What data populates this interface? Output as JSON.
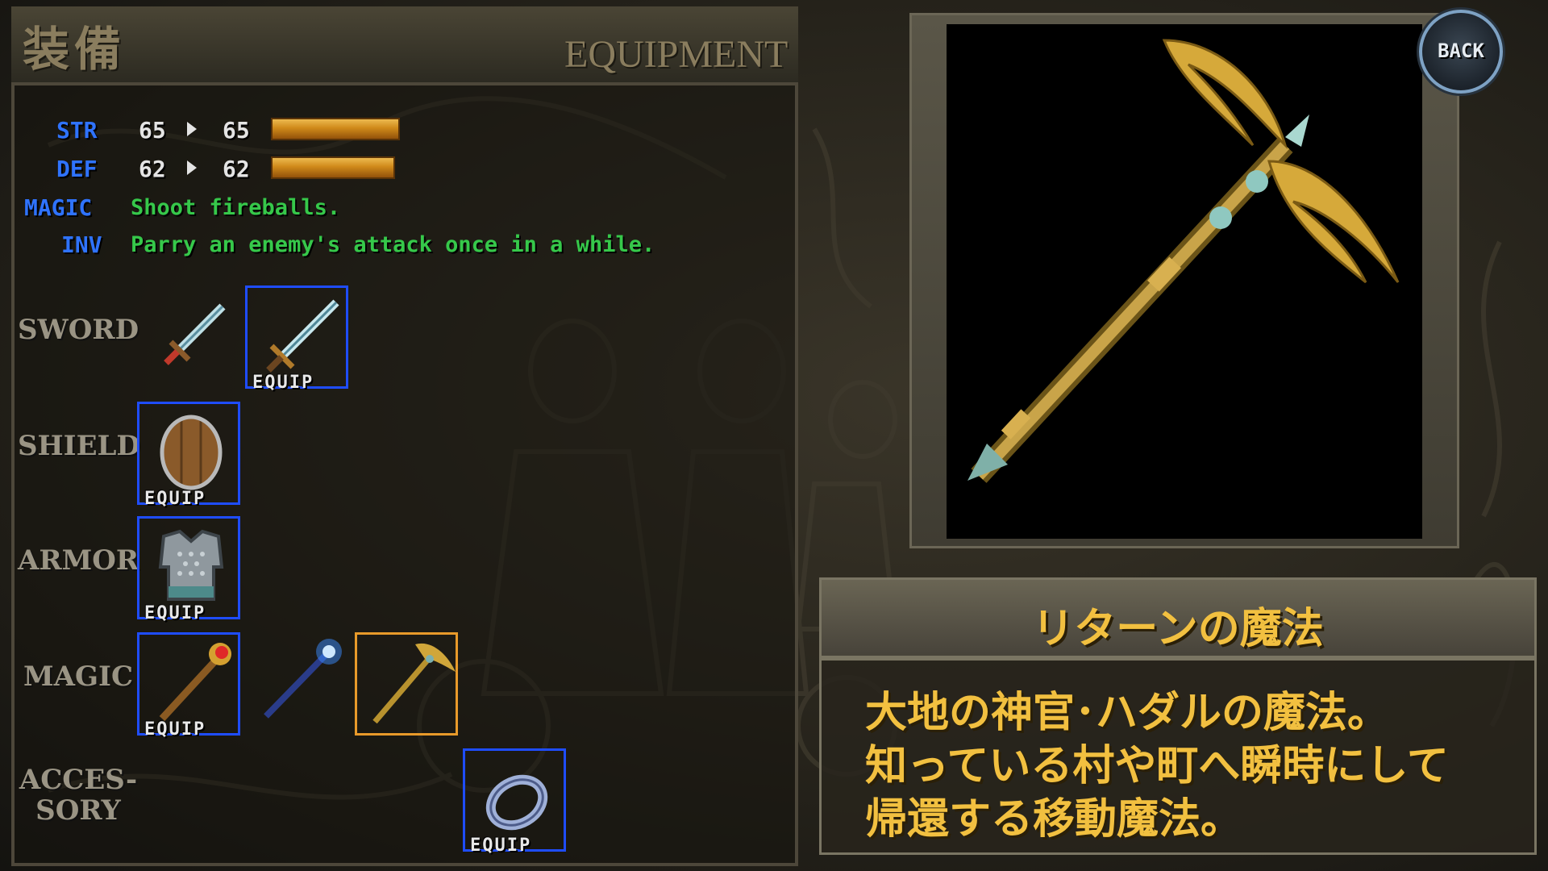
{
  "header": {
    "title_jp": "装備",
    "title_en": "EQUIPMENT"
  },
  "stats": {
    "str": {
      "label": "STR",
      "current": "65",
      "next": "65",
      "level": 0.78
    },
    "def": {
      "label": "DEF",
      "current": "62",
      "next": "62",
      "level": 0.75
    },
    "magic": {
      "label": "MAGIC",
      "text": "Shoot fireballs."
    },
    "inv": {
      "label": "INV",
      "text": "Parry an enemy's attack once in a while."
    }
  },
  "categories": {
    "sword": "SWORD",
    "shield": "SHIELD",
    "armor": "ARMOR",
    "magic": "MAGIC",
    "accessory_line1": "ACCES-",
    "accessory_line2": "SORY"
  },
  "slots": {
    "equip_label": "EQUIP",
    "sword_items": [
      "short-sword-icon",
      "long-sword-icon"
    ],
    "shield_items": [
      "wooden-shield-icon"
    ],
    "armor_items": [
      "chain-mail-icon"
    ],
    "magic_items": [
      "fire-rod-icon",
      "blue-crystal-rod-icon",
      "winged-staff-icon"
    ],
    "accessory_items": [
      "silver-ring-icon"
    ]
  },
  "back_button": {
    "label": "BACK"
  },
  "item": {
    "name": "リターンの魔法",
    "description": [
      "大地の神官･ハダルの魔法。",
      "知っている村や町へ瞬時にして",
      "帰還する移動魔法。"
    ]
  },
  "colors": {
    "stat_label": "#2f73ff",
    "stat_value": "#e4e4e4",
    "desc_green": "#36c84a",
    "equip_border": "#1f4dff",
    "selected_border": "#e89a2a",
    "item_text": "#f2c040"
  }
}
